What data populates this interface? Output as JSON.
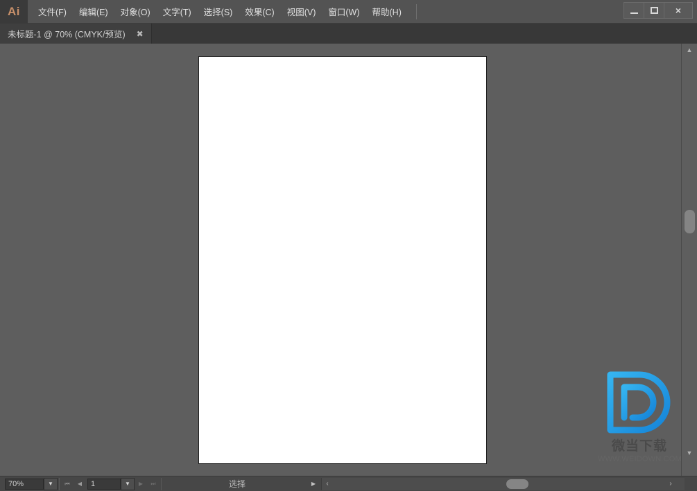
{
  "app": {
    "name": "Ai",
    "logo_color": "#c8906a"
  },
  "menubar": {
    "items": [
      {
        "label": "文件(F)",
        "name": "menu-file"
      },
      {
        "label": "编辑(E)",
        "name": "menu-edit"
      },
      {
        "label": "对象(O)",
        "name": "menu-object"
      },
      {
        "label": "文字(T)",
        "name": "menu-type"
      },
      {
        "label": "选择(S)",
        "name": "menu-select"
      },
      {
        "label": "效果(C)",
        "name": "menu-effect"
      },
      {
        "label": "视图(V)",
        "name": "menu-view"
      },
      {
        "label": "窗口(W)",
        "name": "menu-window"
      },
      {
        "label": "帮助(H)",
        "name": "menu-help"
      }
    ]
  },
  "window_controls": {
    "minimize": "minimize-icon",
    "maximize": "maximize-icon",
    "close": "×"
  },
  "tab": {
    "label": "未标题-1 @ 70% (CMYK/预览)",
    "close": "✖"
  },
  "canvas": {
    "background_color": "#5e5e5e",
    "artboard_color": "#ffffff"
  },
  "watermark": {
    "logo_letter": "D",
    "logo_color": "#29a3e8",
    "text": "微当下载",
    "url": "WWW.WEIDOWN.COM"
  },
  "statusbar": {
    "zoom_value": "70%",
    "zoom_dropdown_icon": "▼",
    "nav_first_icon": "⏮",
    "nav_prev_icon": "◀",
    "page_value": "1",
    "page_dropdown_icon": "▼",
    "nav_next_icon": "▶",
    "nav_last_icon": "⏭",
    "tool_status": "选择",
    "tool_status_arrow": "▶",
    "hscroll_left_icon": "‹",
    "hscroll_right_icon": "›"
  },
  "vscroll": {
    "up_icon": "▲",
    "down_icon": "▼"
  }
}
